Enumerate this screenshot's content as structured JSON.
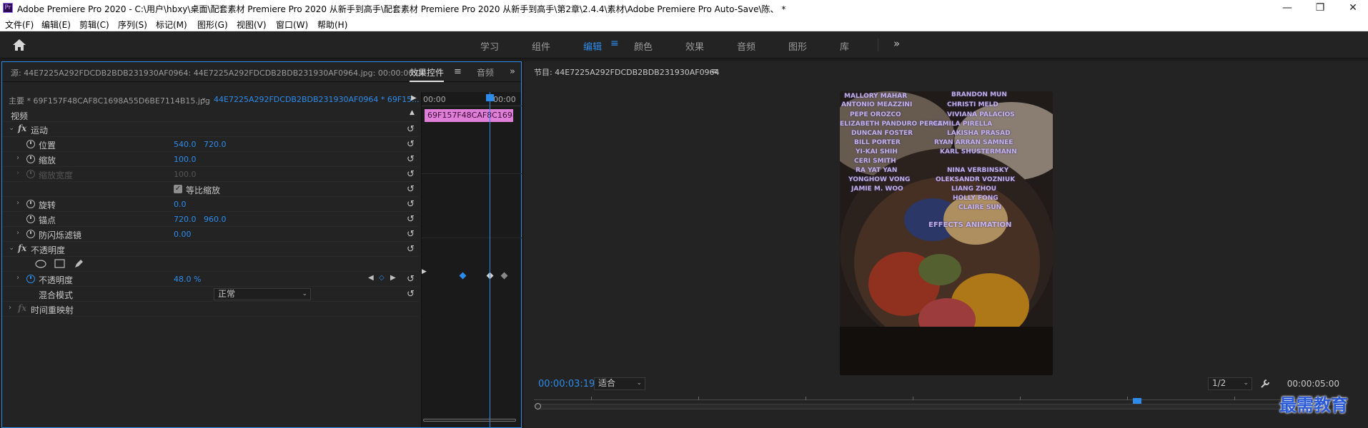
{
  "title_bar": {
    "app_icon": "Pr",
    "title": "Adobe Premiere Pro 2020 - C:\\用户\\hbxy\\桌面\\配套素材 Premiere Pro 2020 从新手到高手\\配套素材 Premiere Pro 2020 从新手到高手\\第2章\\2.4.4\\素材\\Adobe Premiere Pro Auto-Save\\陈、 *",
    "minimize": "—",
    "maximize": "❐",
    "close": "✕"
  },
  "menu": [
    "文件(F)",
    "编辑(E)",
    "剪辑(C)",
    "序列(S)",
    "标记(M)",
    "图形(G)",
    "视图(V)",
    "窗口(W)",
    "帮助(H)"
  ],
  "workspaces": {
    "tabs": [
      "学习",
      "组件",
      "编辑",
      "颜色",
      "效果",
      "音频",
      "图形",
      "库"
    ],
    "active": "编辑",
    "menu_glyph": "≡",
    "more_glyph": "»"
  },
  "effect_controls": {
    "source_label": "源: 44E7225A292FDCDB2BDB231930AF0964: 44E7225A292FDCDB2BDB231930AF0964.jpg: 00:00:00:00",
    "tab_effect_controls": "效果控件",
    "tab_audio": "音频",
    "menu_glyph": "≡",
    "more_glyph": "»",
    "master_label": "主要 * 69F157F48CAF8C1698A55D6BE7114B15.jpg",
    "sequence_label": "44E7225A292FDCDB2BDB231930AF0964 * 69F15...",
    "video_header": "视频",
    "motion": {
      "name": "运动",
      "position": {
        "label": "位置",
        "x": "540.0",
        "y": "720.0"
      },
      "scale": {
        "label": "缩放",
        "value": "100.0"
      },
      "scale_width": {
        "label": "缩放宽度",
        "value": "100.0"
      },
      "uniform_scale": {
        "label": "等比缩放",
        "checked": true
      },
      "rotation": {
        "label": "旋转",
        "value": "0.0"
      },
      "anchor": {
        "label": "锚点",
        "x": "720.0",
        "y": "960.0"
      },
      "anti_flicker": {
        "label": "防闪烁滤镜",
        "value": "0.00"
      }
    },
    "opacity": {
      "name": "不透明度",
      "opacity_label": "不透明度",
      "opacity_value": "48.0 %",
      "blend_label": "混合模式",
      "blend_value": "正常"
    },
    "time_remap": {
      "name": "时间重映射"
    }
  },
  "mini_timeline": {
    "tc_start": "00:00",
    "tc_end": "00:00",
    "clip_label": "69F157F48CAF8C1698A"
  },
  "program_monitor": {
    "title": "节目: 44E7225A292FDCDB2BDB231930AF0964",
    "menu_glyph": "≡",
    "current_time": "00:00:03:19",
    "fit_label": "适合",
    "resolution": "1/2",
    "duration": "00:00:05:00",
    "overlay_names": [
      "MALLORY MAHAR",
      "ANTONIO MEAZZINI",
      "PEPE OROZCO",
      "ELIZABETH PANDURO PEREZ",
      "DUNCAN FOSTER",
      "BILL PORTER",
      "YI-KAI SHIH",
      "CERI SMITH",
      "RA YAT YAN",
      "YONGHOW VONG",
      "JAMIE M. WOO",
      "BRANDON MUN",
      "CHRISTI MELD",
      "VIVIANA PALACIOS",
      "CAMILA PIRELLA",
      "LAKISHA PRASAD",
      "RYAN ARRAN SAMNEE",
      "KARL SHUSTERMANN",
      "NINA VERBINSKY",
      "OLEKSANDR VOZNIUK",
      "LIANG ZHOU",
      "HOLLY FONG",
      "CLAIRE SUN",
      "EFFECTS ANIMATION"
    ]
  },
  "watermark": "最需教育",
  "colors": {
    "accent": "#2d8ceb",
    "clip_pink": "#e07fd8",
    "panel_bg": "#232323"
  }
}
